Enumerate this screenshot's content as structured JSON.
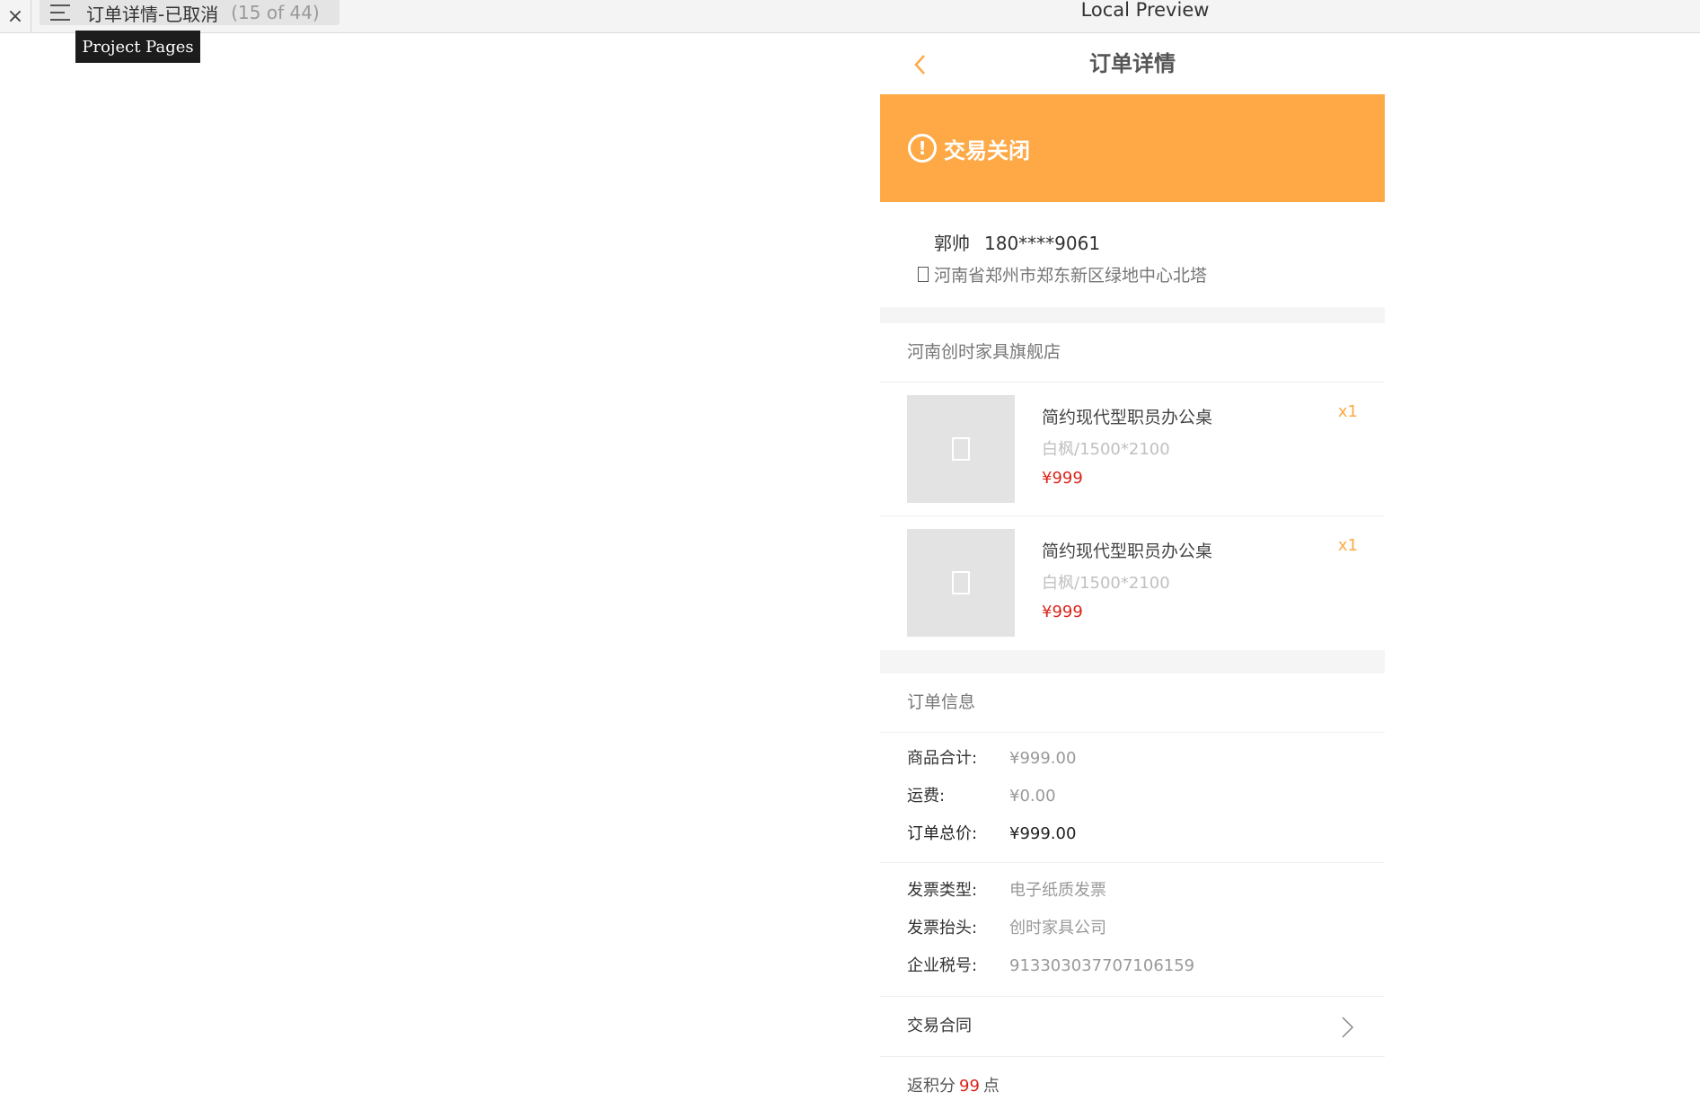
{
  "toolbar": {
    "close_glyph": "×",
    "page_title": "订单详情-已取消",
    "page_count": "(15 of 44)",
    "preview_label": "Local Preview",
    "tooltip": "Project Pages"
  },
  "nav": {
    "title": "订单详情"
  },
  "status": {
    "text": "交易关闭",
    "icon_glyph": "!"
  },
  "address": {
    "name": "郭帅",
    "phone": "180****9061",
    "detail": "河南省郑州市郑东新区绿地中心北塔"
  },
  "shop": {
    "name": "河南创时家具旗舰店",
    "products": [
      {
        "name": "简约现代型职员办公桌",
        "spec": "白枫/1500*2100",
        "price": "¥999",
        "qty": "x1"
      },
      {
        "name": "简约现代型职员办公桌",
        "spec": "白枫/1500*2100",
        "price": "¥999",
        "qty": "x1"
      }
    ]
  },
  "order_info": {
    "header": "订单信息",
    "subtotal": {
      "label": "商品合计:",
      "value": "¥999.00"
    },
    "shipping": {
      "label": "运费:",
      "value": "¥0.00"
    },
    "total": {
      "label": "订单总价:",
      "value": "¥999.00"
    },
    "invoice_type": {
      "label": "发票类型:",
      "value": "电子纸质发票"
    },
    "invoice_title": {
      "label": "发票抬头:",
      "value": "创时家具公司"
    },
    "tax_id": {
      "label": "企业税号:",
      "value": "913303037707106159"
    },
    "contract_label": "交易合同",
    "points_prefix": "返积分",
    "points_value": "99",
    "points_suffix": "点"
  },
  "colors": {
    "accent": "#fea946",
    "price_red": "#d9261c"
  },
  "icons": [
    "close-icon",
    "menu-icon",
    "back-arrow-icon",
    "warning-icon",
    "location-pin-icon",
    "image-placeholder-icon",
    "chevron-right-icon"
  ]
}
